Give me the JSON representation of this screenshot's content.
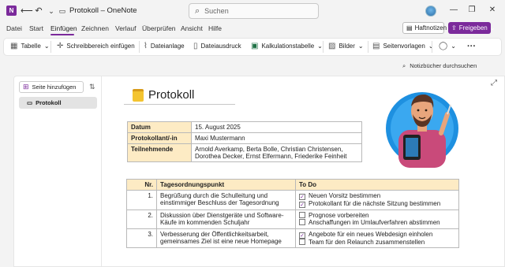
{
  "window": {
    "doc_title": "Protokoll",
    "separator": "–",
    "app_name": "OneNote",
    "app_icon_letter": "N"
  },
  "search": {
    "placeholder": "Suchen"
  },
  "menu": {
    "items": [
      "Datei",
      "Start",
      "Einfügen",
      "Zeichnen",
      "Verlauf",
      "Überprüfen",
      "Ansicht",
      "Hilfe"
    ],
    "active": "Einfügen"
  },
  "header_buttons": {
    "sticky_notes": "Haftnotizen",
    "share": "Freigeben"
  },
  "ribbon": {
    "table": "Tabelle",
    "insert_space": "Schreibbereich einfügen",
    "file_attachment": "Dateianlage",
    "file_printout": "Dateiausdruck",
    "spreadsheet": "Kalkulationstabelle",
    "pictures": "Bilder",
    "page_templates": "Seitenvorlagen"
  },
  "notebook_search": {
    "placeholder": "Notizbücher durchsuchen"
  },
  "sidebar": {
    "add_page": "Seite hinzufügen",
    "pages": [
      "Protokoll"
    ]
  },
  "page": {
    "title": "Protokoll"
  },
  "info_table": [
    {
      "key": "Datum",
      "value": "15. August 2025"
    },
    {
      "key": "Protokollant/-in",
      "value": "Maxi Mustermann"
    },
    {
      "key": "Teilnehmende",
      "value": "Arnold Averkamp, Berta Bolle, Christian Christensen, Dorothea Decker, Ernst Elfermann, Friederike Feinheit"
    }
  ],
  "agenda": {
    "headers": [
      "Nr.",
      "Tagesordnungspunkt",
      "To Do"
    ],
    "rows": [
      {
        "nr": "1.",
        "item": "Begrüßung durch die Schulleitung und einstimmiger Beschluss der Tagesordnung",
        "todos": [
          {
            "text": "Neuen Vorsitz bestimmen",
            "checked": true
          },
          {
            "text": "Protokollant für die nächste Sitzung bestimmen",
            "checked": true
          }
        ]
      },
      {
        "nr": "2.",
        "item": "Diskussion über Dienstgeräte und Software-Käufe im kommenden Schuljahr",
        "todos": [
          {
            "text": "Prognose vorbereiten",
            "checked": false
          },
          {
            "text": "Anschaffungen im Umlaufverfahren abstimmen",
            "checked": false
          }
        ]
      },
      {
        "nr": "3.",
        "item": "Verbesserung der Öffentlichkeitsarbeit, gemeinsames Ziel ist eine neue Homepage",
        "todos": [
          {
            "text": "Angebote für ein neues Webdesign einholen",
            "checked": true
          },
          {
            "text": "Team für den Relaunch zusammenstellen",
            "checked": false
          }
        ]
      }
    ]
  },
  "colors": {
    "accent": "#7b2a9b",
    "table_header": "#fdebc4"
  }
}
